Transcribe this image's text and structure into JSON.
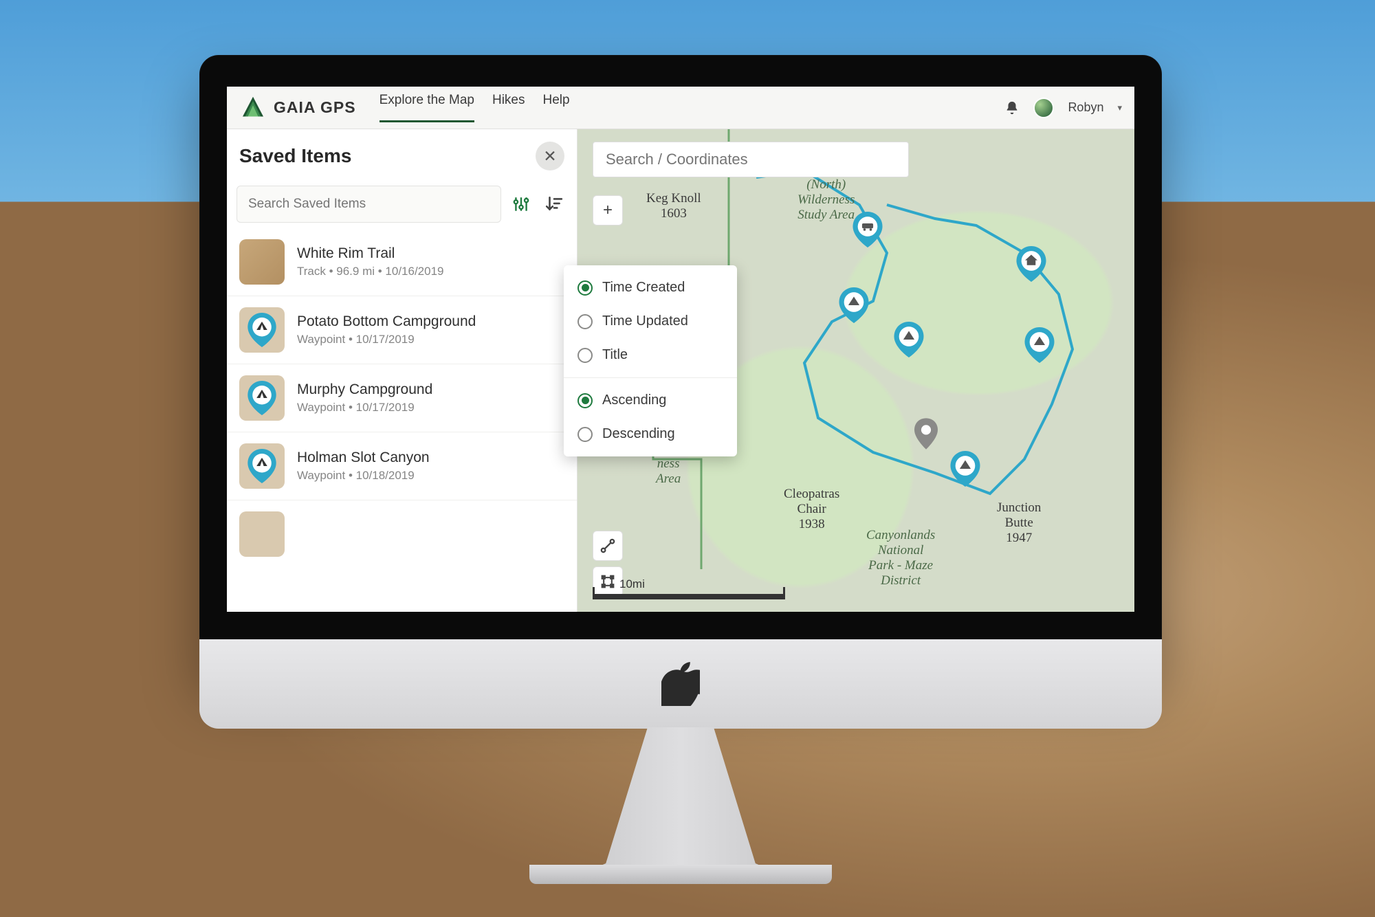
{
  "header": {
    "brand": "GAIA GPS",
    "nav": {
      "explore": "Explore the Map",
      "hikes": "Hikes",
      "help": "Help"
    },
    "user": "Robyn"
  },
  "sidebar": {
    "title": "Saved Items",
    "search_placeholder": "Search Saved Items",
    "items": [
      {
        "title": "White Rim Trail",
        "meta": "Track • 96.9 mi • 10/16/2019",
        "kind": "trail"
      },
      {
        "title": "Potato Bottom Campground",
        "meta": "Waypoint • 10/17/2019",
        "kind": "tent"
      },
      {
        "title": "Murphy Campground",
        "meta": "Waypoint • 10/17/2019",
        "kind": "tent"
      },
      {
        "title": "Holman Slot Canyon",
        "meta": "Waypoint • 10/18/2019",
        "kind": "tent"
      }
    ]
  },
  "sort_menu": {
    "time_created": "Time Created",
    "time_updated": "Time Updated",
    "title": "Title",
    "ascending": "Ascending",
    "descending": "Descending"
  },
  "map": {
    "search_placeholder": "Search / Coordinates",
    "scale_label": "10mi",
    "labels": {
      "wilderness": "(North)\nWilderness\nStudy Area",
      "wilderness2": "ness\nArea",
      "keg": "Keg Knoll\n1603",
      "cleopatra": "Cleopatras\nChair\n1938",
      "junction": "Junction\nButte\n1947",
      "canyonlands": "Canyonlands\nNational\nPark - Maze\nDistrict"
    }
  }
}
